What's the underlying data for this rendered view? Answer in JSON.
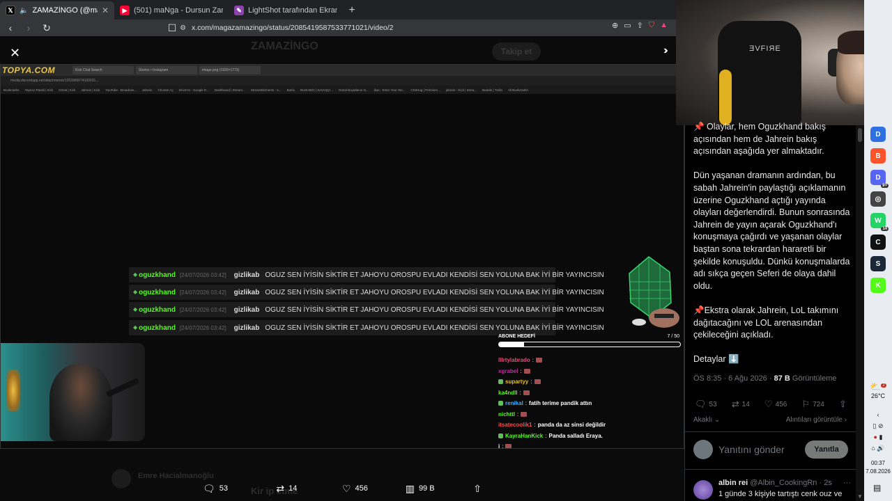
{
  "browser": {
    "tabs": [
      {
        "label": "ZAMAZİNGO (@magazamazi",
        "favicon": "X",
        "color": "#000000",
        "active": true
      },
      {
        "label": "(501) maNga - Dursun Zaman ft. Gök",
        "favicon": "▶",
        "color": "#ff0033",
        "active": false
      },
      {
        "label": "LightShot tarafından Ekran Görüntüs",
        "favicon": "✎",
        "color": "#8e44ad",
        "active": false
      }
    ],
    "new_tab": "+",
    "url": "x.com/magazamazingo/status/2085419587533771021/video/2"
  },
  "viewer": {
    "bg_header": "ZAMAZİNGO",
    "bg_follow": "Takip et",
    "bg_author": "Emre Hacialmanoğlu",
    "bg_cta": "Kir   ip etme"
  },
  "video": {
    "inner_logo": "TOPYA.COM",
    "inner_tabs": [
      "Kick Chat Search",
      "Stories • Instagram",
      "image.png (1920×1773)"
    ],
    "inner_url": "media.discordapp.net/attachments/1253965674100031...",
    "bookmarks": [
      "Bookmarks",
      "Yayıncı Paneli | Kick",
      "Gözat | Kick",
      "Jahrein | Kick",
      "YouTube - Broadcas...",
      "Jahrein",
      "Churam Aç",
      "Drive'ım - Google D...",
      "Dashboard | Stream...",
      "StreamElements - A...",
      "Botrix",
      "BUSHIDO | SAVAŞÇI...",
      "Gönül Boyatlanın N...",
      "ikas - Enter Your Sto...",
      "CS2Hug | Premium...",
      "jahrein - Kick | Strea...",
      "Boards | Trello",
      "All Bookmarks"
    ],
    "chat_lines": [
      {
        "user": "oguzkhand",
        "timestamp": "[24/07/2026 03:42]",
        "target": "gizlikab",
        "message": "OGUZ SEN İYİSİN SİKTİR ET JAHOYU OROSPU EVLADI KENDİSİ SEN YOLUNA BAK İYİ BİR YAYINCISIN"
      },
      {
        "user": "oguzkhand",
        "timestamp": "[24/07/2026 03:42]",
        "target": "gizlikab",
        "message": "OGUZ SEN İYİSİN SİKTİR ET JAHOYU OROSPU EVLADI KENDİSİ SEN YOLUNA BAK İYİ BİR YAYINCISIN"
      },
      {
        "user": "oguzkhand",
        "timestamp": "[24/07/2026 03:42]",
        "target": "gizlikab",
        "message": "OGUZ SEN İYİSİN SİKTİR ET JAHOYU OROSPU EVLADI KENDİSİ SEN YOLUNA BAK İYİ BİR YAYINCISIN"
      },
      {
        "user": "oguzkhand",
        "timestamp": "[24/07/2026 03:42]",
        "target": "gizlikab",
        "message": "OGUZ SEN İYİSİN SİKTİR ET JAHOYU OROSPU EVLADI KENDİSİ SEN YOLUNA BAK İYİ BİR YAYINCISIN"
      }
    ],
    "goal": {
      "title": "ABONE HEDEFİ",
      "count": "7 / 50",
      "progress_fraction": 0.14
    },
    "side_chat": [
      {
        "user": "lllrtylabrado",
        "color": "#e0507a",
        "badge": false,
        "message": "",
        "emote": true
      },
      {
        "user": "xgrabel",
        "color": "#c0309a",
        "badge": false,
        "message": "",
        "emote": true
      },
      {
        "user": "supartyy",
        "color": "#e8c020",
        "badge": true,
        "message": "",
        "emote": true
      },
      {
        "user": "ka4ndll",
        "color": "#53fc18",
        "badge": false,
        "message": "",
        "emote": true
      },
      {
        "user": "renikal",
        "color": "#3ab0ff",
        "badge": true,
        "message": "fatih terime pandik attın",
        "emote": false
      },
      {
        "user": "nichttl",
        "color": "#53fc18",
        "badge": false,
        "message": "",
        "emote": true
      },
      {
        "user": "itsatecoolik1",
        "color": "#ff4a4a",
        "badge": false,
        "message": "panda da az sinsi değildir",
        "emote": false
      },
      {
        "user": "KayraHanKick",
        "color": "#53fc18",
        "badge": true,
        "message": "Panda salladı Eraya.",
        "emote": false
      },
      {
        "user": "i",
        "color": "#ffffff",
        "badge": false,
        "message": "",
        "emote": true
      }
    ]
  },
  "video_actions": {
    "replies": "53",
    "reposts": "14",
    "likes": "456",
    "views": "99 B"
  },
  "webcam": {
    "chair_brand": "ƎVFIЯE"
  },
  "tweet": {
    "paragraphs": [
      "📌 Olaylar, hem Oguzkhand bakış açısından hem de Jahrein bakış açısından aşağıda yer almaktadır.",
      "Dün yaşanan dramanın ardından, bu sabah Jahrein'in paylaştığı açıklamanın üzerine Oguzkhand açtığı yayında olayları değerlendirdi. Bunun sonrasında Jahrein de yayın açarak Oguzkhand'ı konuşmaya çağırdı ve yaşanan olaylar baştan sona tekrardan hararetli bir şekilde konuşuldu. Dünkü konuşmalarda adı sıkça geçen Seferi de olaya dahil oldu.",
      "📌Ekstra olarak Jahrein, LoL takımını dağıtacağını ve LOL arenasından çekileceğini açıkladı.",
      "Detaylar ⬇️"
    ],
    "time": "ÖS 8:35 · 6 Ağu 2026 ·",
    "views_count": "87 B",
    "views_label": "Görüntüleme",
    "stats": {
      "replies": "53",
      "reposts": "14",
      "likes": "456",
      "bookmarks": "724"
    },
    "likes_link": "Akaklı",
    "quotes_link": "Alıntıları görüntüle",
    "reply_placeholder": "Yanıtını gönder",
    "reply_button": "Yanıtla",
    "reply": {
      "name": "albin rei",
      "handle": "@Albin_CookingRn · 2s",
      "text": "1 günde 3 kişiyle tartıştı cenk ouz ve"
    }
  },
  "taskbar": {
    "weather_temp": "26°C",
    "weather_badge": "2",
    "time": "00:37",
    "date": "7.08.2026",
    "apps": [
      {
        "name": "vpn-icon",
        "label": "D",
        "color": "#2f6fe0",
        "badge": ""
      },
      {
        "name": "brave-icon",
        "label": "B",
        "color": "#fb542b",
        "badge": ""
      },
      {
        "name": "discord-icon",
        "label": "D",
        "color": "#5865f2",
        "badge": "9+"
      },
      {
        "name": "chatgpt-icon",
        "label": "◎",
        "color": "#444444",
        "badge": ""
      },
      {
        "name": "whatsapp-icon",
        "label": "W",
        "color": "#25d366",
        "badge": "14"
      },
      {
        "name": "capcut-icon",
        "label": "C",
        "color": "#111111",
        "badge": ""
      },
      {
        "name": "steam-icon",
        "label": "S",
        "color": "#1b2838",
        "badge": ""
      },
      {
        "name": "kick-icon",
        "label": "K",
        "color": "#53fc18",
        "badge": ""
      }
    ]
  }
}
